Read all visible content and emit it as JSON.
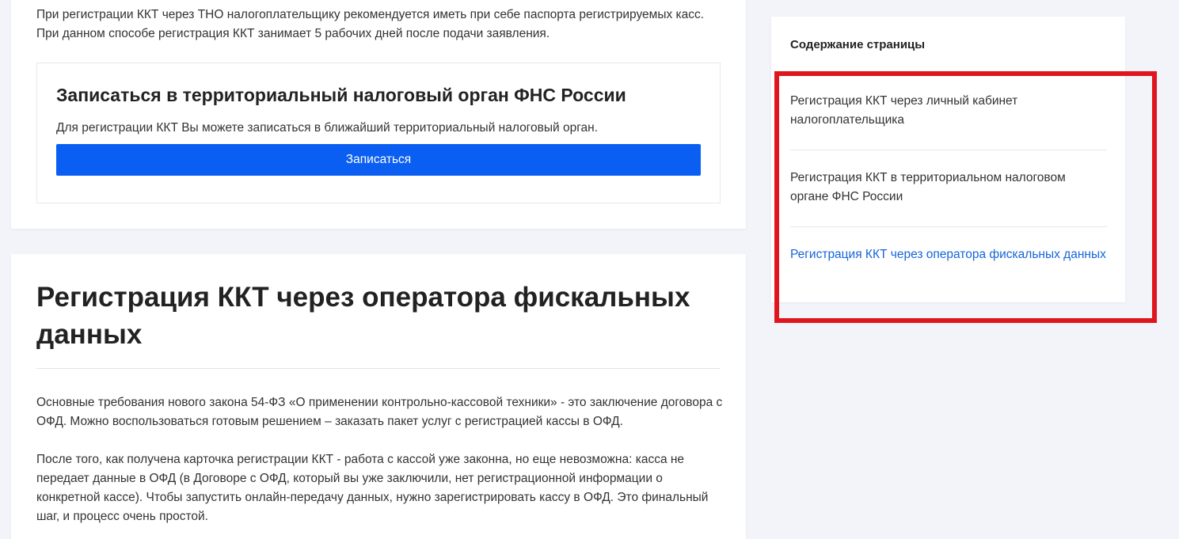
{
  "intro": {
    "text": "При регистрации ККТ через ТНО налогоплательщику рекомендуется иметь при себе паспорта регистрируемых касс. При данном способе регистрация ККТ занимает 5 рабочих дней после подачи заявления."
  },
  "signup": {
    "title": "Записаться в территориальный налоговый орган ФНС России",
    "description": "Для регистрации ККТ Вы можете записаться в ближайший территориальный налоговый орган.",
    "button_label": "Записаться"
  },
  "section": {
    "title": "Регистрация ККТ через оператора фискальных данных",
    "paragraphs": [
      "Основные требования нового закона 54-ФЗ «О применении контрольно-кассовой техники» - это заключение договора с ОФД. Можно воспользоваться готовым решением – заказать пакет услуг с регистрацией кассы в ОФД.",
      "После того, как получена карточка регистрации ККТ - работа с кассой уже законна, но еще невозможна: касса не передает данные в ОФД (в Договоре с ОФД, который вы уже заключили, нет регистрационной информации о конкретной кассе). Чтобы запустить онлайн-передачу данных, нужно зарегистрировать кассу в ОФД. Это финальный шаг, и процесс очень простой."
    ]
  },
  "toc": {
    "title": "Содержание страницы",
    "items": [
      {
        "label": "Регистрация ККТ через личный кабинет налогоплательщика",
        "active": false
      },
      {
        "label": "Регистрация ККТ в территориальном налоговом органе ФНС России",
        "active": false
      },
      {
        "label": "Регистрация ККТ через оператора фискальных данных",
        "active": true
      }
    ]
  },
  "colors": {
    "background": "#f2f4f9",
    "button": "#0a5ff2",
    "active_link": "#1565d8",
    "highlight": "#e0161e"
  }
}
